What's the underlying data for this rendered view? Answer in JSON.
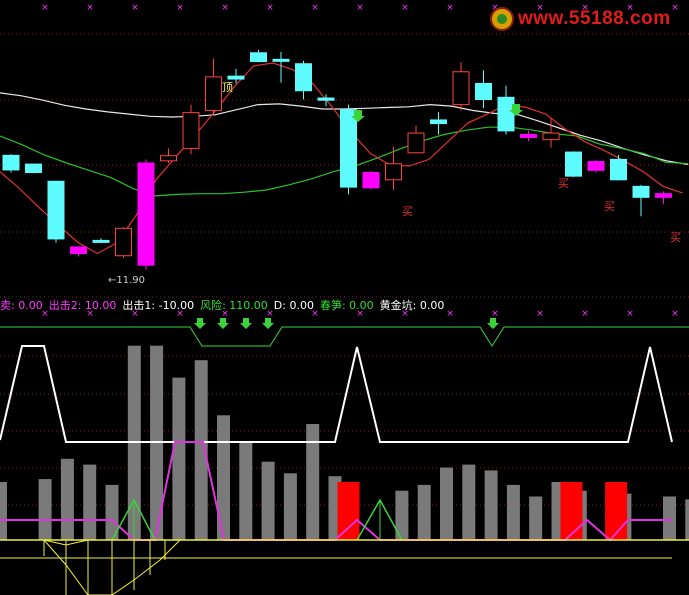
{
  "watermark": {
    "text": "www.55188.com"
  },
  "price_chart": {
    "candles": [
      {
        "o": 173.5,
        "c": 153.5,
        "h": 175,
        "l": 150,
        "kind": "down"
      },
      {
        "o": 161.5,
        "c": 150.0,
        "h": 162,
        "l": 149,
        "kind": "down"
      },
      {
        "o": 138.0,
        "c": 59.0,
        "h": 139,
        "l": 54,
        "kind": "down"
      },
      {
        "o": 48.0,
        "c": 39.0,
        "h": 49,
        "l": 35,
        "kind": "up"
      },
      {
        "o": 57.0,
        "c": 54.5,
        "h": 60,
        "l": 53,
        "kind": "doji"
      },
      {
        "o": 36.0,
        "c": 73.5,
        "h": 75,
        "l": 33,
        "kind": "hollow"
      },
      {
        "o": 23.0,
        "c": 163.0,
        "h": 168,
        "l": 17,
        "kind": "up"
      },
      {
        "o": 166.0,
        "c": 173.0,
        "h": 183,
        "l": 163,
        "kind": "hollow"
      },
      {
        "o": 183.0,
        "c": 232.0,
        "h": 243,
        "l": 175,
        "kind": "hollow"
      },
      {
        "o": 235.0,
        "c": 281.0,
        "h": 306,
        "l": 230,
        "kind": "hollow"
      },
      {
        "o": 282.0,
        "c": 278.0,
        "h": 292,
        "l": 272,
        "kind": "down"
      },
      {
        "o": 314.0,
        "c": 302.0,
        "h": 318,
        "l": 301,
        "kind": "down"
      },
      {
        "o": 305.0,
        "c": 303.0,
        "h": 315,
        "l": 273,
        "kind": "doji"
      },
      {
        "o": 299.0,
        "c": 262.0,
        "h": 303,
        "l": 250,
        "kind": "down"
      },
      {
        "o": 252.0,
        "c": 249.0,
        "h": 257,
        "l": 241,
        "kind": "down"
      },
      {
        "o": 236.0,
        "c": 130.0,
        "h": 243,
        "l": 120,
        "kind": "down"
      },
      {
        "o": 150.0,
        "c": 129.0,
        "h": 152,
        "l": 127,
        "kind": "up"
      },
      {
        "o": 140.0,
        "c": 162.0,
        "h": 185,
        "l": 126,
        "kind": "hollow"
      },
      {
        "o": 177.0,
        "c": 204.0,
        "h": 214,
        "l": 176,
        "kind": "hollow"
      },
      {
        "o": 222.0,
        "c": 217.0,
        "h": 233,
        "l": 202,
        "kind": "doji"
      },
      {
        "o": 243.0,
        "c": 288.0,
        "h": 301,
        "l": 235,
        "kind": "hollow"
      },
      {
        "o": 272.0,
        "c": 250.0,
        "h": 290,
        "l": 238,
        "kind": "down"
      },
      {
        "o": 253.0,
        "c": 207.0,
        "h": 269,
        "l": 202,
        "kind": "down"
      },
      {
        "o": 202.0,
        "c": 198.0,
        "h": 207,
        "l": 193,
        "kind": "up"
      },
      {
        "o": 195.0,
        "c": 204.0,
        "h": 225,
        "l": 184,
        "kind": "hollow"
      },
      {
        "o": 178.0,
        "c": 145.0,
        "h": 179,
        "l": 144,
        "kind": "down"
      },
      {
        "o": 165.0,
        "c": 153.0,
        "h": 167,
        "l": 150,
        "kind": "up"
      },
      {
        "o": 168.0,
        "c": 140.0,
        "h": 174,
        "l": 139,
        "kind": "down"
      },
      {
        "o": 131.0,
        "c": 116.0,
        "h": 133,
        "l": 90,
        "kind": "down"
      },
      {
        "o": 121.0,
        "c": 116.0,
        "h": 124,
        "l": 107,
        "kind": "up"
      }
    ],
    "ma_white": [
      259,
      255,
      249,
      242,
      237,
      233,
      230,
      227,
      226,
      227,
      229,
      236,
      243,
      244,
      241,
      237,
      237,
      238,
      239,
      240,
      243,
      241,
      235,
      231,
      230,
      221,
      211,
      201,
      193,
      183,
      174,
      166,
      161
    ],
    "ma_green": [
      200,
      188,
      174,
      163,
      153,
      143,
      128,
      118,
      120,
      121,
      121,
      123,
      126,
      133,
      141,
      151,
      159,
      170,
      182,
      193,
      202,
      208,
      212,
      212,
      208,
      203,
      200,
      189,
      183,
      176,
      164,
      162
    ],
    "ma_red": [
      151,
      128,
      102,
      78,
      54,
      39,
      54,
      92,
      140,
      171,
      201,
      233,
      267,
      296,
      300,
      291,
      273,
      241,
      205,
      176,
      160,
      159,
      168,
      193,
      218,
      230,
      244,
      239,
      230,
      209,
      192,
      180,
      166,
      151,
      131,
      122
    ],
    "labels": {
      "top": "顶",
      "buy": "买",
      "low_price": "←11.90"
    }
  },
  "indicator_header": {
    "items": [
      {
        "label": "卖: 0.00",
        "color": "#ff3cff"
      },
      {
        "label": "出击2: 10.00",
        "color": "#ff3cff"
      },
      {
        "label": "出击1: -10.00",
        "color": "#ffffff"
      },
      {
        "label": "风险: 110.00",
        "color": "#33dd33"
      },
      {
        "label": "D: 0.00",
        "color": "#ffffff"
      },
      {
        "label": "春笋: 0.00",
        "color": "#33dd33"
      },
      {
        "label": "黄金坑: 0.00",
        "color": "#ffffff"
      }
    ]
  },
  "indicator_chart": {
    "gray_bars": [
      20,
      0,
      21,
      28,
      26,
      19,
      67,
      67,
      56,
      62,
      43,
      34,
      27,
      23,
      40,
      22,
      0,
      0,
      17,
      19,
      25,
      26,
      24,
      19,
      15,
      20,
      17,
      0,
      16,
      0,
      15,
      14
    ],
    "red_bars": [
      {
        "i": 15,
        "v": 20
      },
      {
        "i": 25,
        "v": 20
      },
      {
        "i": 27,
        "v": 20
      }
    ],
    "risk_line": [
      71,
      71,
      71,
      71,
      71,
      71,
      71,
      71,
      71,
      71,
      71,
      71,
      71,
      71,
      71,
      71,
      71,
      71,
      71,
      71,
      71,
      71,
      71,
      71,
      71,
      71,
      71,
      71,
      71
    ],
    "colors": {
      "candle_up": "#ff00ff",
      "candle_down": "#5ffcff",
      "candle_hollow": "#ff4040",
      "ma_white": "#e8e8e8",
      "ma_green": "#29c229",
      "ma_red": "#e23030",
      "grid_red": "#8c1a1a",
      "gray_bar": "#7a7a7a",
      "red_bar": "#ff0000",
      "signal_white": "#ffffff",
      "signal_magenta": "#e033e0",
      "signal_green": "#3ad43a",
      "signal_yellow": "#f0f03a",
      "arrow_green": "#3ad43a",
      "marker_magenta": "#ff33ff"
    }
  }
}
